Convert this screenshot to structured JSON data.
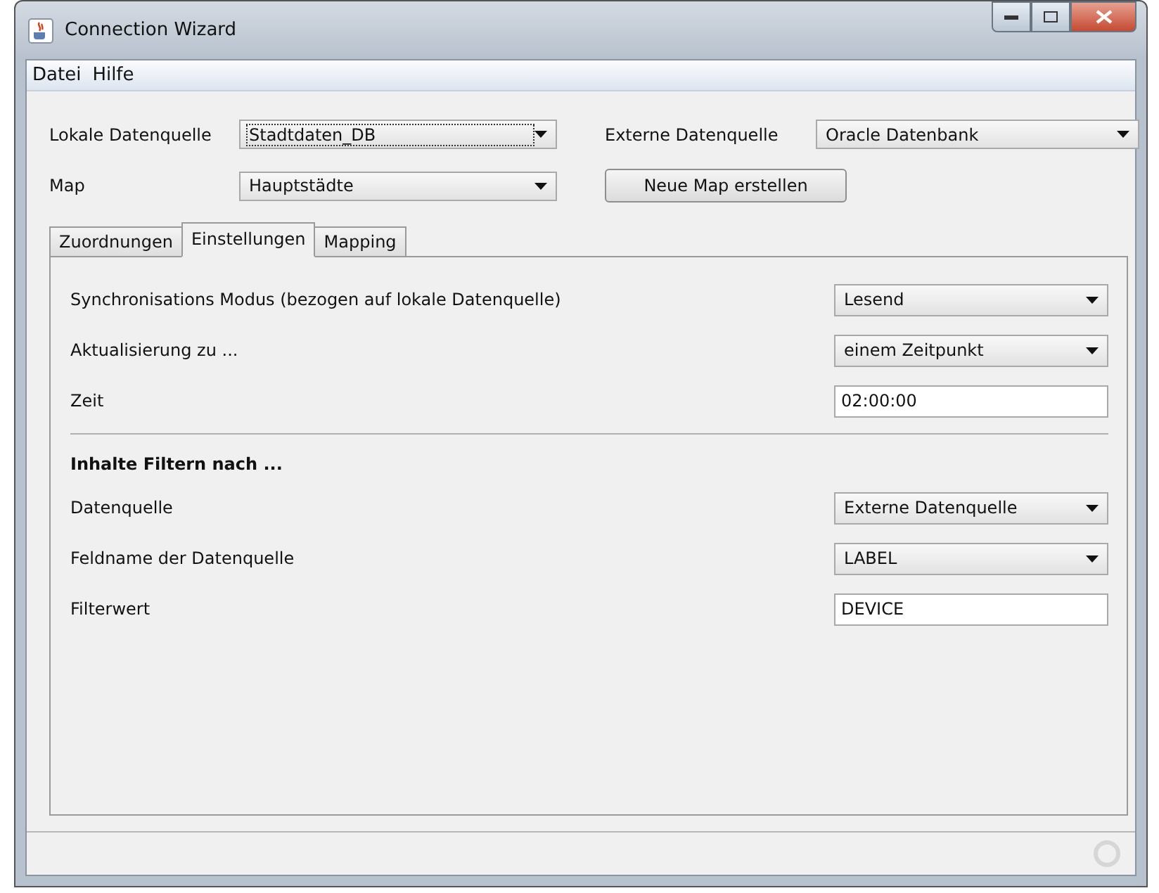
{
  "window": {
    "title": "Connection Wizard"
  },
  "menu": [
    "Datei",
    "Hilfe"
  ],
  "source_fields": [
    {
      "label": "Lokale Datenquelle",
      "value": "Stadtdaten_DB",
      "focused": true
    },
    {
      "label": "Externe Datenquelle",
      "value": "Oracle Datenbank",
      "focused": false
    }
  ],
  "map": {
    "label": "Map",
    "value": "Hauptstädte",
    "focused": false
  },
  "new_map_button": "Neue Map erstellen",
  "tabs": [
    {
      "label": "Zuordnungen",
      "selected": false
    },
    {
      "label": "Einstellungen",
      "selected": true
    },
    {
      "label": "Mapping",
      "selected": false
    }
  ],
  "sync_rows": [
    {
      "kind": "select",
      "label": "Synchronisations Modus (bezogen auf lokale Datenquelle)",
      "value": "Lesend"
    },
    {
      "kind": "select",
      "label": "Aktualisierung zu ...",
      "value": "einem Zeitpunkt"
    },
    {
      "kind": "text",
      "label": "Zeit",
      "value": "02:00:00"
    }
  ],
  "filter": {
    "heading": "Inhalte Filtern nach ...",
    "rows": [
      {
        "kind": "select",
        "label": "Datenquelle",
        "value": "Externe Datenquelle"
      },
      {
        "kind": "select",
        "label": "Feldname der Datenquelle",
        "value": "LABEL"
      },
      {
        "kind": "text",
        "label": "Filterwert",
        "value": "DEVICE"
      }
    ]
  }
}
